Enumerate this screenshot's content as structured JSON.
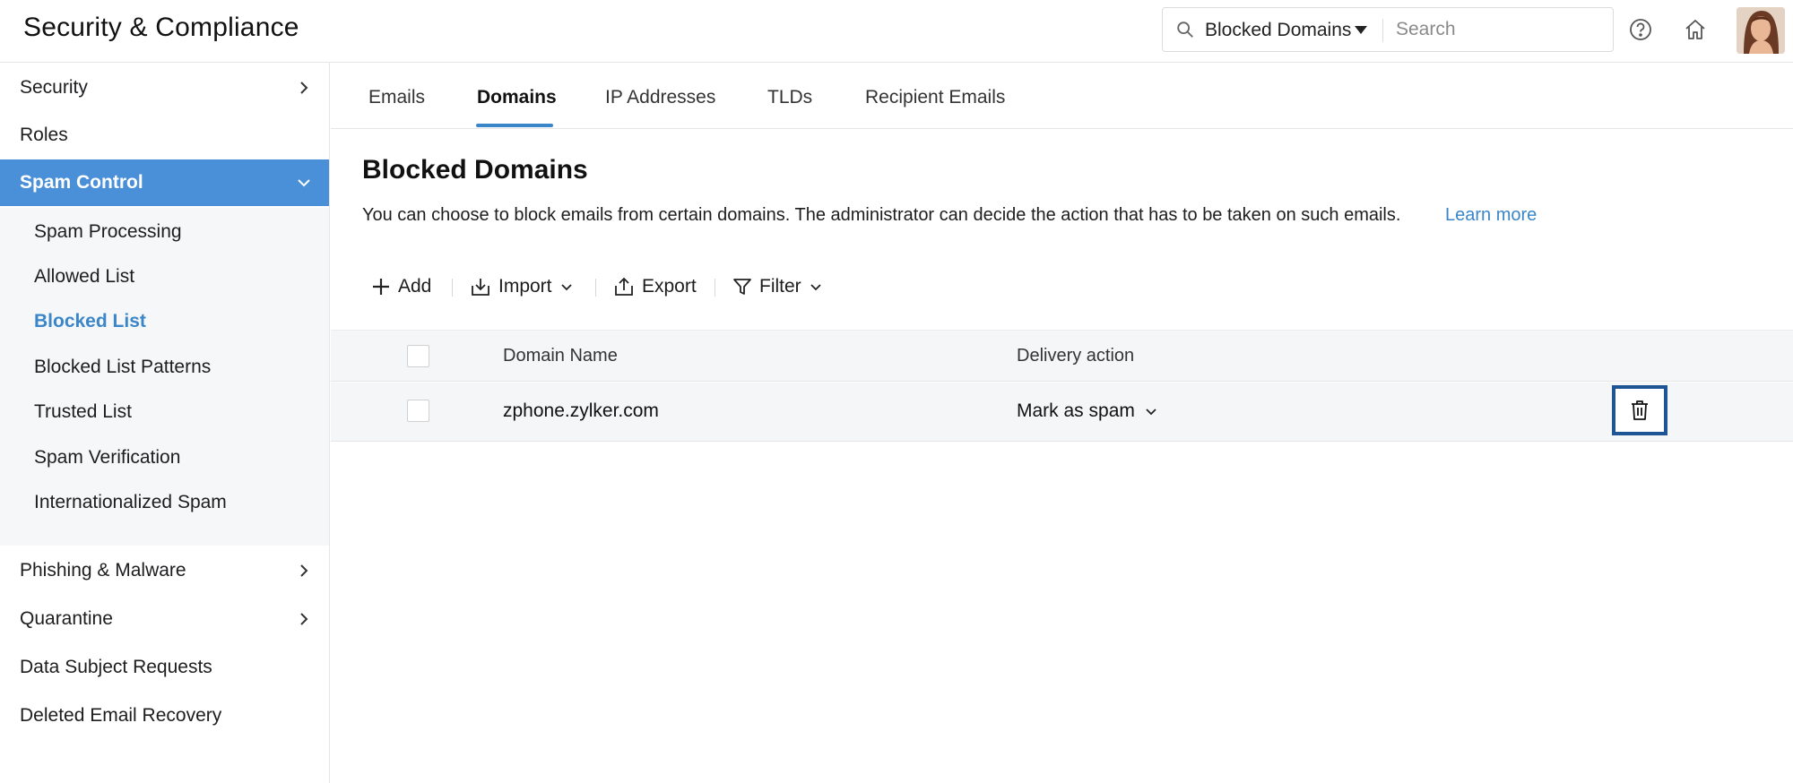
{
  "app": {
    "title": "Security & Compliance"
  },
  "search": {
    "scope": "Blocked Domains",
    "placeholder": "Search"
  },
  "sidebar": {
    "items": [
      {
        "label": "Security"
      },
      {
        "label": "Roles"
      },
      {
        "label": "Spam Control"
      },
      {
        "label": "Phishing & Malware"
      },
      {
        "label": "Quarantine"
      },
      {
        "label": "Data Subject Requests"
      },
      {
        "label": "Deleted Email Recovery"
      }
    ],
    "spam_submenu": [
      {
        "label": "Spam Processing"
      },
      {
        "label": "Allowed List"
      },
      {
        "label": "Blocked List"
      },
      {
        "label": "Blocked List Patterns"
      },
      {
        "label": "Trusted List"
      },
      {
        "label": "Spam Verification"
      },
      {
        "label": "Internationalized Spam"
      }
    ]
  },
  "tabs": [
    {
      "label": "Emails"
    },
    {
      "label": "Domains"
    },
    {
      "label": "IP Addresses"
    },
    {
      "label": "TLDs"
    },
    {
      "label": "Recipient Emails"
    }
  ],
  "main": {
    "title": "Blocked Domains",
    "description": "You can choose to block emails from certain domains. The administrator can decide the action that has to be taken on such emails.",
    "learn_more": "Learn more"
  },
  "toolbar": {
    "add": "Add",
    "import": "Import",
    "export": "Export",
    "filter": "Filter"
  },
  "table": {
    "columns": [
      "Domain Name",
      "Delivery action"
    ],
    "rows": [
      {
        "domain": "zphone.zylker.com",
        "action": "Mark as spam"
      }
    ]
  },
  "colors": {
    "accent": "#3a86c8",
    "active_nav": "#4a90d9",
    "focus_border": "#1f5594"
  }
}
